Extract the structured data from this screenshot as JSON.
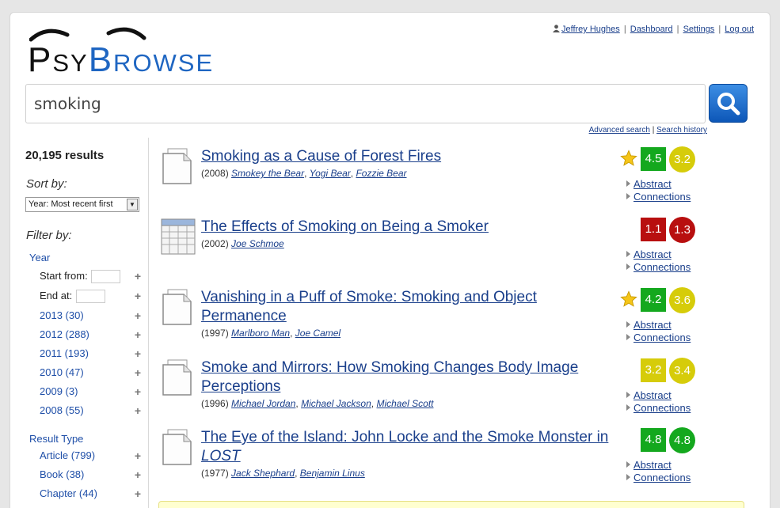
{
  "header": {
    "logo": {
      "part1": "Psy",
      "part2": "Browse"
    },
    "user": {
      "name": "Jeffrey Hughes",
      "links": [
        "Dashboard",
        "Settings",
        "Log out"
      ],
      "separator": "|"
    }
  },
  "search": {
    "query": "smoking",
    "advanced_link": "Advanced search",
    "history_link": "Search history",
    "separator": "|"
  },
  "sidebar": {
    "results_count": "20,195 results",
    "sort_label": "Sort by:",
    "sort_value": "Year: Most recent first",
    "filter_label": "Filter by:",
    "year_group": {
      "title": "Year",
      "start_label": "Start from:",
      "end_label": "End at:",
      "items": [
        "2013 (30)",
        "2012 (288)",
        "2011 (193)",
        "2010 (47)",
        "2009 (3)",
        "2008 (55)"
      ]
    },
    "type_group": {
      "title": "Result Type",
      "items": [
        "Article (799)",
        "Book (38)",
        "Chapter (44)"
      ]
    },
    "plus": "+"
  },
  "results": [
    {
      "title": "Smoking as a Cause of Forest Fires",
      "title_em": "",
      "year": "(2008)",
      "authors": [
        "Smokey the Bear",
        "Yogi Bear",
        "Fozzie Bear"
      ],
      "starred": true,
      "score1": "4.5",
      "score2": "3.2",
      "icon": "document-icon",
      "abstract": "Abstract",
      "connections": "Connections"
    },
    {
      "title": "The Effects of Smoking on Being a Smoker",
      "title_em": "",
      "year": "(2002)",
      "authors": [
        "Joe Schmoe"
      ],
      "starred": false,
      "score1": "1.1",
      "score2": "1.3",
      "icon": "spreadsheet-icon",
      "abstract": "Abstract",
      "connections": "Connections"
    },
    {
      "title": "Vanishing in a Puff of Smoke: Smoking and Object Permanence",
      "title_em": "",
      "year": "(1997)",
      "authors": [
        "Marlboro Man",
        "Joe Camel"
      ],
      "starred": true,
      "score1": "4.2",
      "score2": "3.6",
      "icon": "document-icon",
      "abstract": "Abstract",
      "connections": "Connections"
    },
    {
      "title": "Smoke and Mirrors: How Smoking Changes Body Image Perceptions",
      "title_em": "",
      "year": "(1996)",
      "authors": [
        "Michael Jordan",
        "Michael Jackson",
        "Michael Scott"
      ],
      "starred": false,
      "score1": "3.2",
      "score2": "3.4",
      "icon": "document-icon",
      "abstract": "Abstract",
      "connections": "Connections"
    },
    {
      "title": "The Eye of the Island: John Locke and the Smoke Monster in ",
      "title_em": "LOST",
      "year": "(1977)",
      "authors": [
        "Jack Shephard",
        "Benjamin Linus"
      ],
      "starred": false,
      "score1": "4.8",
      "score2": "4.8",
      "icon": "document-icon",
      "abstract": "Abstract",
      "connections": "Connections"
    }
  ],
  "colors": {
    "green": "#14a81e",
    "red": "#b80f0f",
    "yellow": "#d6cc0a",
    "link": "#1a3f8b",
    "brand_blue": "#1f66c2"
  }
}
